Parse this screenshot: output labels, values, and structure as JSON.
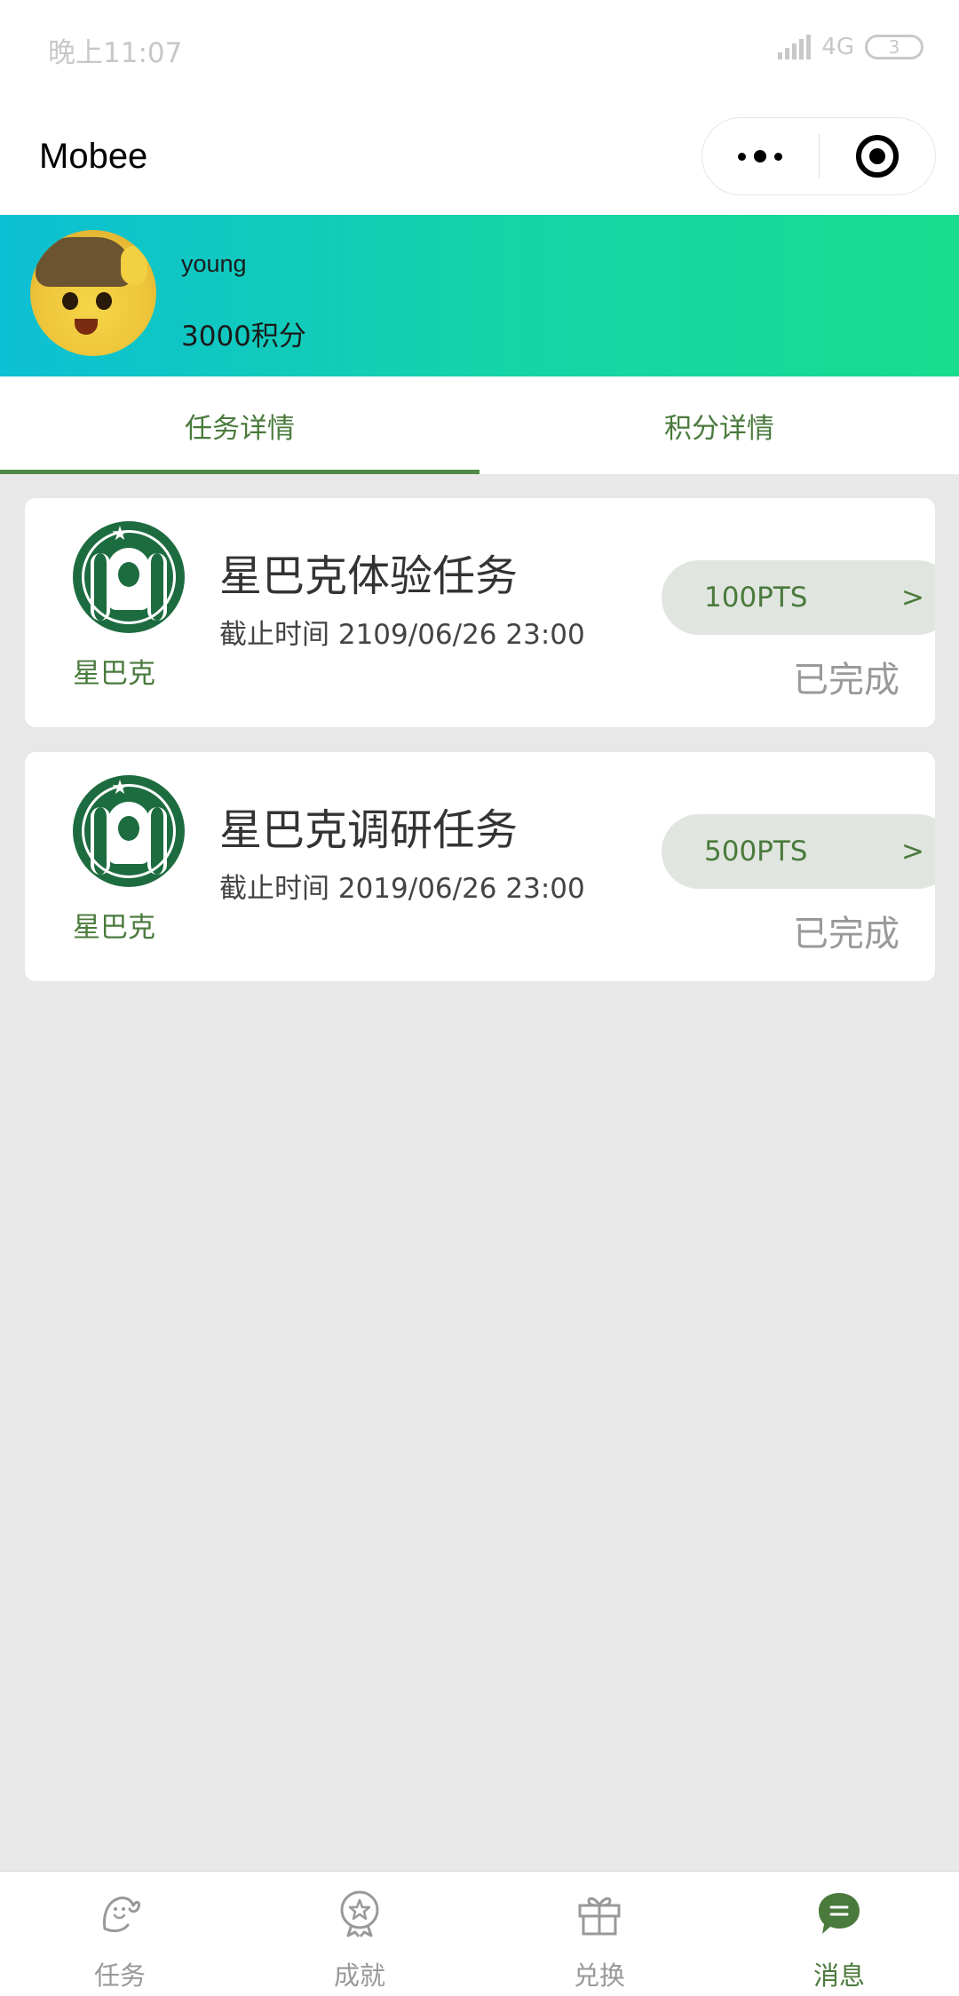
{
  "status_bar": {
    "time": "晚上11:07",
    "network": "4G",
    "battery": "3"
  },
  "nav": {
    "title": "Mobee"
  },
  "profile": {
    "username": "young",
    "points": "3000积分"
  },
  "tabs": [
    {
      "label": "任务详情",
      "active": true
    },
    {
      "label": "积分详情",
      "active": false
    }
  ],
  "tasks": [
    {
      "brand": "星巴克",
      "title": "星巴克体验任务",
      "deadline": "截止时间 2109/06/26 23:00",
      "pts": "100PTS",
      "chevron": ">",
      "status": "已完成"
    },
    {
      "brand": "星巴克",
      "title": "星巴克调研任务",
      "deadline": "截止时间 2019/06/26 23:00",
      "pts": "500PTS",
      "chevron": ">",
      "status": "已完成"
    }
  ],
  "bottom_tabs": [
    {
      "label": "任务",
      "icon": "mascot-icon",
      "active": false
    },
    {
      "label": "成就",
      "icon": "medal-icon",
      "active": false
    },
    {
      "label": "兑换",
      "icon": "gift-icon",
      "active": false
    },
    {
      "label": "消息",
      "icon": "message-icon",
      "active": true
    }
  ],
  "colors": {
    "accent": "#4a7a3c",
    "banner_start": "#0dbfd4",
    "banner_end": "#19dc8f",
    "brand_green": "#1d6c40"
  }
}
